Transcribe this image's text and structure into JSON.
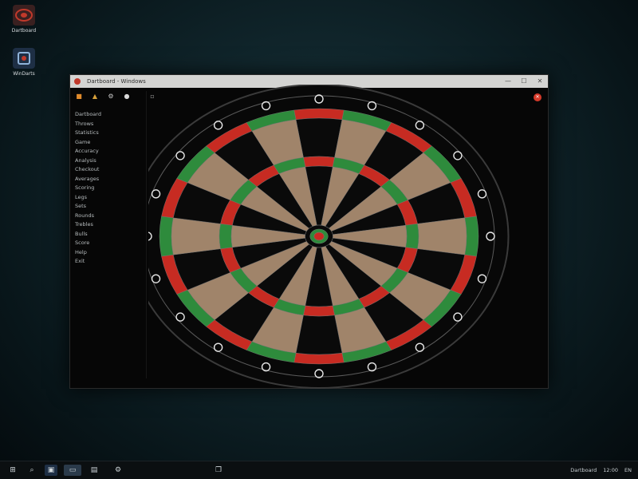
{
  "desktop": {
    "icons": [
      {
        "label": "Dartboard",
        "color": "#c0392b"
      },
      {
        "label": "WinDarts",
        "color": "#3b6ea8"
      }
    ]
  },
  "window": {
    "title": "Dartboard - Windows",
    "controls": {
      "minimize": "—",
      "maximize": "☐",
      "close": "✕"
    }
  },
  "toolbar": {
    "icons": [
      "folder-icon",
      "open-icon",
      "settings-icon",
      "record-icon",
      "marker-icon"
    ]
  },
  "sidebar": {
    "items": [
      "Dartboard",
      "Throws",
      "Statistics",
      "Game",
      "Accuracy",
      "Analysis",
      "Checkout",
      "Averages",
      "Scoring",
      "Legs",
      "Sets",
      "Rounds",
      "Trebles",
      "Bulls",
      "Score",
      "Help",
      "Exit"
    ]
  },
  "board": {
    "colors": {
      "black": "#0a0a0a",
      "cream": "#a0846a",
      "red": "#c72b22",
      "green": "#2e8b3c",
      "wire": "#7a7a7a",
      "outer": "#080808"
    }
  },
  "taskbar": {
    "tray": [
      "Dartboard",
      "12:00",
      "EN"
    ]
  }
}
